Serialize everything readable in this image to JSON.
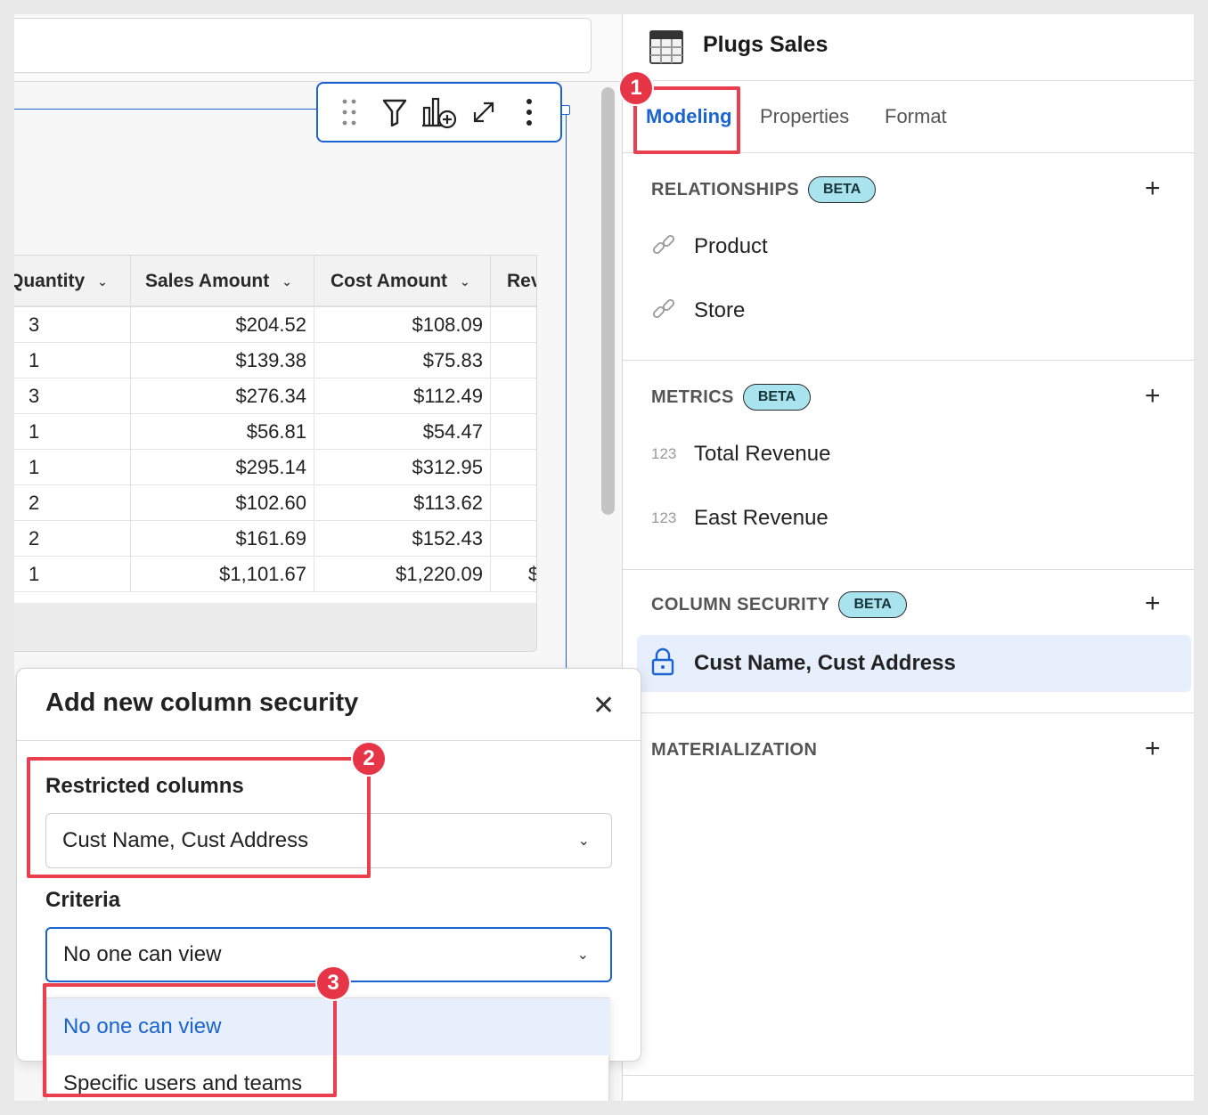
{
  "panel": {
    "title": "Plugs Sales",
    "tabs": [
      "Modeling",
      "Properties",
      "Format"
    ],
    "sections": {
      "relationships": {
        "label": "RELATIONSHIPS",
        "badge": "BETA",
        "items": [
          "Product",
          "Store"
        ]
      },
      "metrics": {
        "label": "METRICS",
        "badge": "BETA",
        "icon_text": "123",
        "items": [
          "Total Revenue",
          "East Revenue"
        ]
      },
      "column_security": {
        "label": "COLUMN SECURITY",
        "badge": "BETA",
        "items": [
          "Cust Name, Cust Address"
        ]
      },
      "materialization": {
        "label": "MATERIALIZATION"
      }
    }
  },
  "table": {
    "headers": [
      "Quantity",
      "Sales Amount",
      "Cost Amount",
      "Rev"
    ],
    "rows": [
      [
        "3",
        "$204.52",
        "$108.09",
        ""
      ],
      [
        "1",
        "$139.38",
        "$75.83",
        ""
      ],
      [
        "3",
        "$276.34",
        "$112.49",
        ""
      ],
      [
        "1",
        "$56.81",
        "$54.47",
        ""
      ],
      [
        "1",
        "$295.14",
        "$312.95",
        ""
      ],
      [
        "2",
        "$102.60",
        "$113.62",
        ""
      ],
      [
        "2",
        "$161.69",
        "$152.43",
        ""
      ],
      [
        "1",
        "$1,101.67",
        "$1,220.09",
        "$"
      ]
    ]
  },
  "modal": {
    "title": "Add new column security",
    "restricted_label": "Restricted columns",
    "restricted_value": "Cust Name, Cust Address",
    "criteria_label": "Criteria",
    "criteria_value": "No one can view",
    "options": [
      "No one can view",
      "Specific users and teams"
    ]
  },
  "annotations": [
    "1",
    "2",
    "3"
  ],
  "colors": {
    "accent": "#1b63d0",
    "annotation": "#ea3f4f",
    "beta": "#a9e4ee"
  }
}
